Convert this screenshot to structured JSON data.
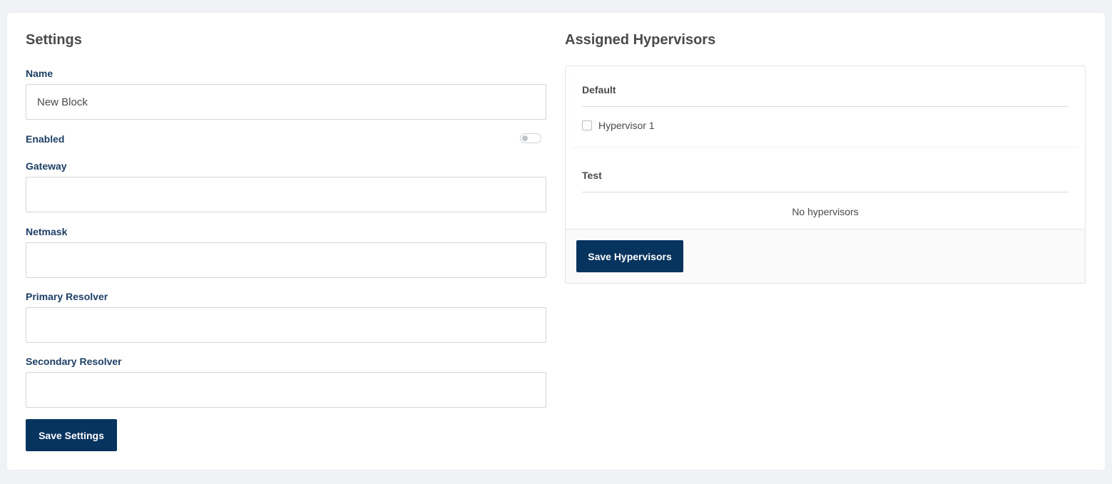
{
  "settings": {
    "title": "Settings",
    "fields": {
      "name": {
        "label": "Name",
        "value": "New Block",
        "placeholder": ""
      },
      "enabled": {
        "label": "Enabled",
        "checked": false
      },
      "gateway": {
        "label": "Gateway",
        "value": "",
        "placeholder": ""
      },
      "netmask": {
        "label": "Netmask",
        "value": "",
        "placeholder": ""
      },
      "primary_resolver": {
        "label": "Primary Resolver",
        "value": "",
        "placeholder": ""
      },
      "secondary_resolver": {
        "label": "Secondary Resolver",
        "value": "",
        "placeholder": ""
      }
    },
    "save_label": "Save Settings"
  },
  "hypervisors": {
    "title": "Assigned Hypervisors",
    "groups": [
      {
        "name": "Default",
        "items": [
          {
            "label": "Hypervisor 1",
            "checked": false
          }
        ]
      },
      {
        "name": "Test",
        "items": [],
        "empty_text": "No hypervisors"
      }
    ],
    "save_label": "Save Hypervisors"
  },
  "colors": {
    "primary": "#07335f",
    "label": "#1d3f66",
    "text": "#4a4a4a",
    "background": "#f1f2f6"
  }
}
